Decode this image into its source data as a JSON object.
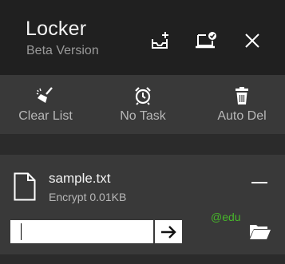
{
  "header": {
    "title": "Locker",
    "subtitle": "Beta Version",
    "icons": [
      "add-files-icon",
      "laptop-check-icon",
      "close-icon"
    ]
  },
  "toolbar": {
    "items": [
      {
        "label": "Clear List",
        "icon": "broom-icon"
      },
      {
        "label": "No Task",
        "icon": "alarm-clock-icon"
      },
      {
        "label": "Auto Del",
        "icon": "trash-icon"
      }
    ]
  },
  "file": {
    "name": "sample.txt",
    "status": "Encrypt 0.01KB",
    "password_value": "",
    "watermark": "@edu"
  },
  "colors": {
    "header_bg": "#202020",
    "panel_bg": "#393939",
    "page_bg": "#2b2b2b",
    "watermark": "#47b52a"
  }
}
